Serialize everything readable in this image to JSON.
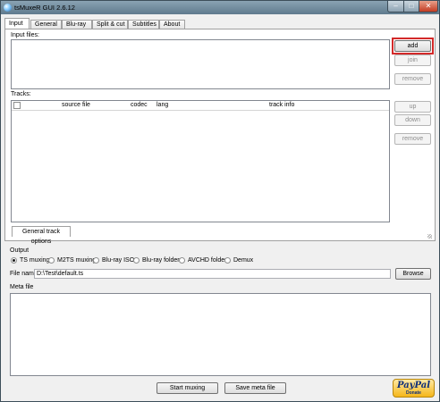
{
  "window": {
    "title": "tsMuxeR GUI 2.6.12",
    "controls": {
      "minimize": "–",
      "maximize": "□",
      "close": "✕"
    }
  },
  "tabs": [
    {
      "label": "Input",
      "active": true
    },
    {
      "label": "General"
    },
    {
      "label": "Blu-ray"
    },
    {
      "label": "Split & cut"
    },
    {
      "label": "Subtitles"
    },
    {
      "label": "About"
    }
  ],
  "input": {
    "input_files_label": "Input files:",
    "add_button": "add",
    "join_button": "join",
    "remove_button": "remove",
    "tracks_label": "Tracks:",
    "columns": [
      "source file",
      "codec",
      "lang",
      "track info"
    ],
    "up_button": "up",
    "down_button": "down",
    "track_remove_button": "remove",
    "general_track_options_tab": "General track options"
  },
  "output": {
    "label": "Output",
    "modes": [
      {
        "label": "TS muxing",
        "checked": true
      },
      {
        "label": "M2TS muxing",
        "checked": false
      },
      {
        "label": "Blu-ray ISO",
        "checked": false
      },
      {
        "label": "Blu-ray folder",
        "checked": false
      },
      {
        "label": "AVCHD folder",
        "checked": false
      },
      {
        "label": "Demux",
        "checked": false
      }
    ],
    "file_name_label": "File name",
    "file_name_value": "D:\\Test\\default.ts",
    "browse_button": "Browse"
  },
  "meta": {
    "label": "Meta file"
  },
  "footer": {
    "start_muxing": "Start muxing",
    "save_meta_file": "Save meta file",
    "paypal_brand": "PayPal",
    "paypal_sub": "Donate"
  },
  "colors": {
    "focus_highlight": "#d32a2a",
    "titlebar": "#7490a3"
  }
}
